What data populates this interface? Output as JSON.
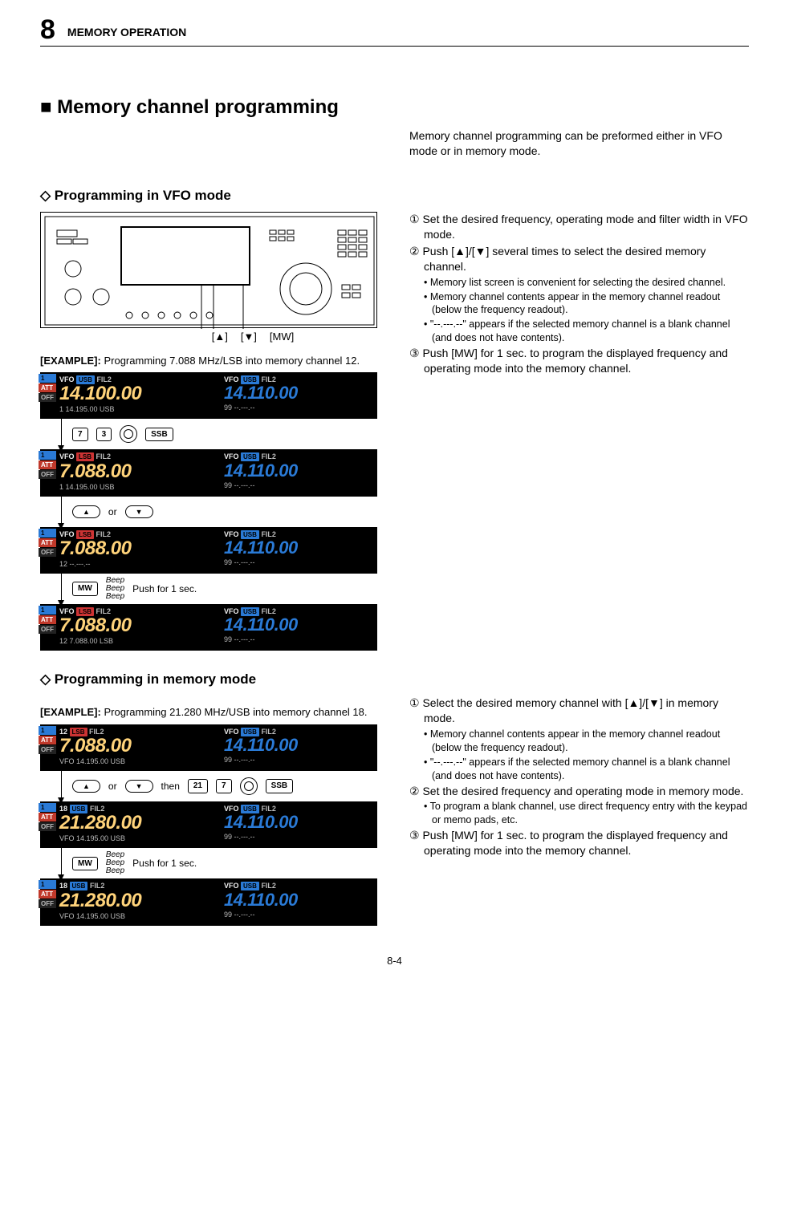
{
  "header": {
    "chapter_number": "8",
    "chapter_title": "MEMORY OPERATION"
  },
  "main_heading": "■ Memory channel programming",
  "intro": "Memory channel programming can be preformed either in VFO mode or in memory mode.",
  "vfo": {
    "heading": "◇ Programming in VFO mode",
    "radio_labels": {
      "up": "[▲]",
      "down": "[▼]",
      "mw": "[MW]"
    },
    "example_label": "[EXAMPLE]:",
    "example_text": "Programming 7.088 MHz/LSB into memory channel 12.",
    "strips": [
      {
        "main": {
          "prefix": "VFO",
          "mode": "USB",
          "mode_color": "blue",
          "fil": "FIL2",
          "freq": "14.100.00",
          "mem": "1  14.195.00 USB"
        },
        "sub": {
          "prefix": "VFO",
          "mode": "USB",
          "mode_color": "blue",
          "fil": "FIL2",
          "freq": "14.110.00",
          "mem": "99  --.---.--"
        }
      },
      {
        "main": {
          "prefix": "VFO",
          "mode": "LSB",
          "mode_color": "red",
          "fil": "FIL2",
          "freq": "7.088.00",
          "mem": "1  14.195.00 USB"
        },
        "sub": {
          "prefix": "VFO",
          "mode": "USB",
          "mode_color": "blue",
          "fil": "FIL2",
          "freq": "14.110.00",
          "mem": "99  --.---.--"
        }
      },
      {
        "main": {
          "prefix": "VFO",
          "mode": "LSB",
          "mode_color": "red",
          "fil": "FIL2",
          "freq": "7.088.00",
          "mem": "12  --.---.--"
        },
        "sub": {
          "prefix": "VFO",
          "mode": "USB",
          "mode_color": "blue",
          "fil": "FIL2",
          "freq": "14.110.00",
          "mem": "99  --.---.--"
        }
      },
      {
        "main": {
          "prefix": "VFO",
          "mode": "LSB",
          "mode_color": "red",
          "fil": "FIL2",
          "freq": "7.088.00",
          "mem": "12   7.088.00 LSB"
        },
        "sub": {
          "prefix": "VFO",
          "mode": "USB",
          "mode_color": "blue",
          "fil": "FIL2",
          "freq": "14.110.00",
          "mem": "99  --.---.--"
        }
      }
    ],
    "step1": {
      "btn1": "7",
      "btn2": "3",
      "btn3": "SSB"
    },
    "step2_or": "or",
    "step3": {
      "btn": "MW",
      "beep": "Beep",
      "push": "Push for 1 sec."
    },
    "right": {
      "r1": "① Set the desired frequency, operating mode and filter width in VFO mode.",
      "r2": "② Push [▲]/[▼] several times to select the desired memory channel.",
      "r2a": "• Memory list screen is convenient for selecting the desired channel.",
      "r2b": "• Memory channel contents appear in the memory channel readout (below the frequency readout).",
      "r2c": "• \"--.---.--\" appears if the selected memory channel is a blank channel (and does not have contents).",
      "r3": "③ Push [MW] for 1 sec. to program the displayed frequency and operating mode into the memory channel."
    }
  },
  "mem": {
    "heading": "◇ Programming in memory mode",
    "example_label": "[EXAMPLE]:",
    "example_text": "Programming 21.280 MHz/USB into memory channel 18.",
    "strips": [
      {
        "main": {
          "prefix": "12",
          "mode": "LSB",
          "mode_color": "red",
          "fil": "FIL2",
          "freq": "7.088.00",
          "mem": "VFO 14.195.00 USB"
        },
        "sub": {
          "prefix": "VFO",
          "mode": "USB",
          "mode_color": "blue",
          "fil": "FIL2",
          "freq": "14.110.00",
          "mem": "99  --.---.--"
        }
      },
      {
        "main": {
          "prefix": "18",
          "mode": "USB",
          "mode_color": "blue",
          "fil": "FIL2",
          "freq": "21.280.00",
          "mem": "VFO 14.195.00 USB"
        },
        "sub": {
          "prefix": "VFO",
          "mode": "USB",
          "mode_color": "blue",
          "fil": "FIL2",
          "freq": "14.110.00",
          "mem": "99  --.---.--"
        }
      },
      {
        "main": {
          "prefix": "18",
          "mode": "USB",
          "mode_color": "blue",
          "fil": "FIL2",
          "freq": "21.280.00",
          "mem": "VFO 14.195.00 USB"
        },
        "sub": {
          "prefix": "VFO",
          "mode": "USB",
          "mode_color": "blue",
          "fil": "FIL2",
          "freq": "14.110.00",
          "mem": "99  --.---.--"
        }
      }
    ],
    "step1": {
      "or": "or",
      "then": "then",
      "btn1": "21",
      "btn2": "7",
      "btn3": "SSB"
    },
    "step2": {
      "btn": "MW",
      "beep": "Beep",
      "push": "Push for 1 sec."
    },
    "right": {
      "r1": "① Select the desired memory channel with [▲]/[▼] in memory mode.",
      "r1a": "• Memory channel contents appear in the memory channel readout (below the frequency readout).",
      "r1b": "• \"--.---.--\" appears if the selected memory channel is a blank channel (and does not have contents).",
      "r2": "② Set the desired frequency and operating mode in memory mode.",
      "r2a": "• To program a blank channel, use direct frequency entry with the keypad or memo pads, etc.",
      "r3": "③ Push [MW] for 1 sec. to program the displayed frequency and operating mode into the memory channel."
    }
  },
  "badges": {
    "one": "1",
    "att": "ATT",
    "off": "OFF"
  },
  "page_number": "8-4"
}
